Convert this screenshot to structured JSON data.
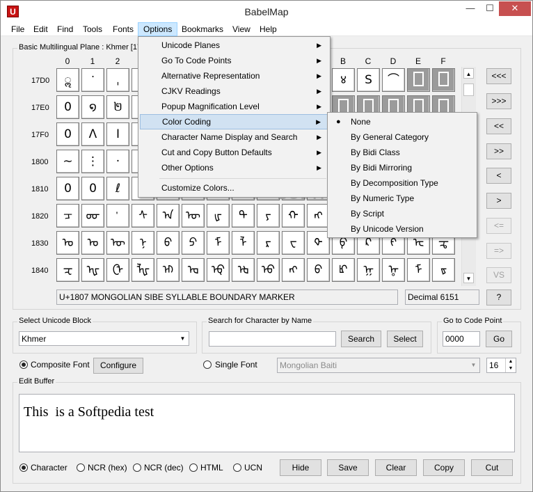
{
  "window": {
    "title": "BabelMap",
    "app_icon": "U",
    "minimize": "—",
    "maximize": "☐",
    "close": "✕"
  },
  "menubar": [
    "File",
    "Edit",
    "Find",
    "Tools",
    "Fonts",
    "Options",
    "Bookmarks",
    "View",
    "Help"
  ],
  "grid": {
    "label": "Basic Multilingual Plane : Khmer [178",
    "columns": [
      "0",
      "1",
      "2",
      "3",
      "4",
      "5",
      "6",
      "7",
      "8",
      "9",
      "A",
      "B",
      "C",
      "D",
      "E",
      "F"
    ],
    "rows": [
      "17D0",
      "17E0",
      "17F0",
      "1800",
      "1810",
      "1820",
      "1830",
      "1840"
    ],
    "cells": [
      [
        "ॢ",
        "ॱ",
        "ˌ",
        "",
        "",
        "",
        "",
        "",
        "",
        "",
        "",
        "४",
        "S",
        "⌒",
        "",
        ""
      ],
      [
        "0",
        "໑",
        "២",
        "៣",
        "៤",
        "៥",
        "៦",
        "៧",
        "៨",
        "៩",
        "",
        "",
        "",
        "",
        "",
        ""
      ],
      [
        "0",
        "Λ",
        "I",
        "",
        "",
        "",
        "",
        "",
        "",
        "",
        "",
        "",
        "",
        "",
        "",
        ""
      ],
      [
        "∼",
        "⋮",
        "·",
        "",
        "",
        "",
        "",
        "",
        "",
        "",
        "",
        "",
        "",
        "",
        "",
        ""
      ],
      [
        "0",
        "0",
        "ℓ",
        "",
        "",
        "",
        "",
        "",
        "",
        "",
        "",
        "",
        "",
        "",
        "",
        ""
      ],
      [
        "ᠴ",
        "ᡂ",
        "ᡃ",
        "ᠰ",
        "ᠠ",
        "ᠦ",
        "ᡁ",
        "ᠲ",
        "ᠶ",
        "ᠬ",
        "ᠩ",
        "",
        "",
        "",
        "",
        ""
      ],
      [
        "ᠣ",
        "ᠤ",
        "ᠥ",
        "ᠨ",
        "ᠪ",
        "ᠫ",
        "ᠮ",
        "ᠯ",
        "ᠷ",
        "ᠸ",
        "ᡐ",
        "ᠹ",
        "ᠺ",
        "ᠻ",
        "ᡄ",
        "ᠼ"
      ],
      [
        "ᠽ",
        "ᠾ",
        "ᠿ",
        "ᡀ",
        "ᡅ",
        "ᡆ",
        "ᡇ",
        "ᡈ",
        "ᡉ",
        "ᡊ",
        "ᡋ",
        "ᡌ",
        "ᡍ",
        "ᡎ",
        "ᡏ",
        "ᡑ"
      ]
    ],
    "placeholder_cells": [
      [
        0,
        14
      ],
      [
        0,
        15
      ],
      [
        1,
        11
      ],
      [
        1,
        12
      ],
      [
        1,
        13
      ],
      [
        1,
        14
      ],
      [
        1,
        15
      ]
    ],
    "char_name": "U+1807 MONGOLIAN SIBE SYLLABLE BOUNDARY MARKER",
    "decimal": "Decimal 6151"
  },
  "nav_buttons": [
    "<<<",
    ">>>",
    "<<",
    ">>",
    "<",
    ">",
    "<=",
    "=>",
    "VS",
    "?"
  ],
  "select_block": {
    "label": "Select Unicode Block",
    "value": "Khmer"
  },
  "search": {
    "label": "Search for Character by Name",
    "value": "",
    "search_btn": "Search",
    "select_btn": "Select"
  },
  "goto": {
    "label": "Go to Code Point",
    "value": "0000",
    "go_btn": "Go"
  },
  "font": {
    "composite": "Composite Font",
    "configure": "Configure",
    "single": "Single Font",
    "single_value": "Mongolian Baiti",
    "size": "16"
  },
  "edit_buffer": {
    "label": "Edit Buffer",
    "text": "This  is a Softpedia test"
  },
  "output_modes": [
    "Character",
    "NCR (hex)",
    "NCR (dec)",
    "HTML",
    "UCN"
  ],
  "buffer_buttons": [
    "Hide",
    "Save",
    "Clear",
    "Copy",
    "Cut"
  ],
  "options_menu": [
    "Unicode Planes",
    "Go To Code Points",
    "Alternative Representation",
    "CJKV Readings",
    "Popup Magnification Level",
    "Color Coding",
    "Character Name Display and Search",
    "Cut and Copy Button Defaults",
    "Other Options",
    "Customize Colors..."
  ],
  "color_coding_menu": [
    "None",
    "By General Category",
    "By Bidi Class",
    "By Bidi Mirroring",
    "By Decomposition Type",
    "By Numeric Type",
    "By Script",
    "By Unicode Version"
  ],
  "watermark": "SOFTPEDIA"
}
